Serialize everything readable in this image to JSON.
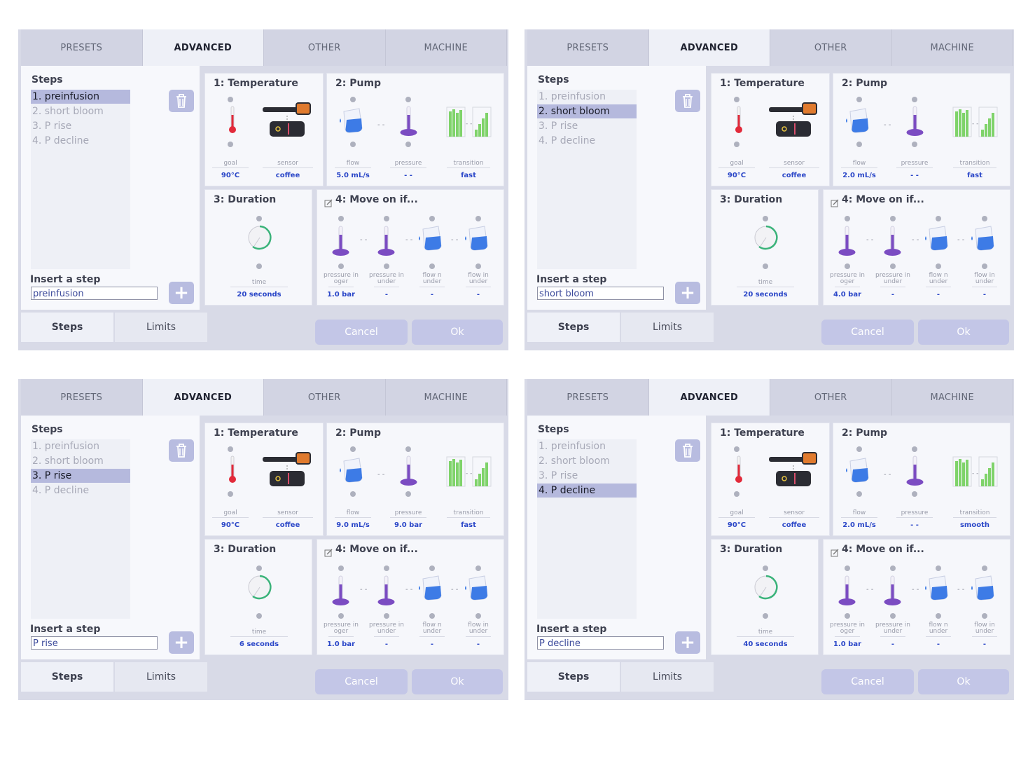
{
  "tabs": [
    "PRESETS",
    "ADVANCED",
    "OTHER",
    "MACHINE"
  ],
  "steps_label": "Steps",
  "insert_label": "Insert a step",
  "bottom_tabs": [
    "Steps",
    "Limits"
  ],
  "cancel_label": "Cancel",
  "ok_label": "Ok",
  "section_titles": {
    "temp": "1: Temperature",
    "pump": "2: Pump",
    "duration": "3: Duration",
    "moveon": "4: Move on if..."
  },
  "labels": {
    "goal": "goal",
    "sensor": "sensor",
    "flow": "flow",
    "pressure": "pressure",
    "transition": "transition",
    "time": "time",
    "pressure_over": "pressure in oger",
    "pressure_under": "pressure in under",
    "flow_over": "flow n under",
    "flow_under": "flow in under"
  },
  "colors": {
    "accent": "#b5b9dd",
    "value_blue": "#2b47c8",
    "thermo_red": "#e22a3a",
    "pump_purple": "#7b4cc2",
    "timer_green": "#3bb37a",
    "bars_green": "#7fd36a"
  },
  "screens": [
    {
      "step_names": [
        "1. preinfusion",
        "2. short bloom",
        "3. P rise",
        "4. P decline"
      ],
      "selected": 0,
      "insert_value": "preinfusion",
      "temp": {
        "goal": "90°C",
        "sensor": "coffee"
      },
      "pump": {
        "flow": "5.0 mL/s",
        "pressure": "- -",
        "transition": "fast"
      },
      "duration": "20 seconds",
      "moveon": [
        "1.0 bar",
        "-",
        "-",
        "-"
      ]
    },
    {
      "step_names": [
        "1. preinfusion",
        "2. short bloom",
        "3. P rise",
        "4. P decline"
      ],
      "selected": 1,
      "insert_value": "short bloom",
      "temp": {
        "goal": "90°C",
        "sensor": "coffee"
      },
      "pump": {
        "flow": "2.0 mL/s",
        "pressure": "- -",
        "transition": "fast"
      },
      "duration": "20 seconds",
      "moveon": [
        "4.0 bar",
        "-",
        "-",
        "-"
      ]
    },
    {
      "step_names": [
        "1. preinfusion",
        "2. short bloom",
        "3. P rise",
        "4. P decline"
      ],
      "selected": 2,
      "insert_value": "P rise",
      "temp": {
        "goal": "90°C",
        "sensor": "coffee"
      },
      "pump": {
        "flow": "9.0 mL/s",
        "pressure": "9.0 bar",
        "transition": "fast"
      },
      "duration": "6 seconds",
      "moveon": [
        "1.0 bar",
        "-",
        "-",
        "-"
      ]
    },
    {
      "step_names": [
        "1. preinfusion",
        "2. short bloom",
        "3. P rise",
        "4. P decline"
      ],
      "selected": 3,
      "insert_value": "P decline",
      "temp": {
        "goal": "90°C",
        "sensor": "coffee"
      },
      "pump": {
        "flow": "2.0 mL/s",
        "pressure": "- -",
        "transition": "smooth"
      },
      "duration": "40 seconds",
      "moveon": [
        "1.0 bar",
        "-",
        "-",
        "-"
      ]
    }
  ]
}
